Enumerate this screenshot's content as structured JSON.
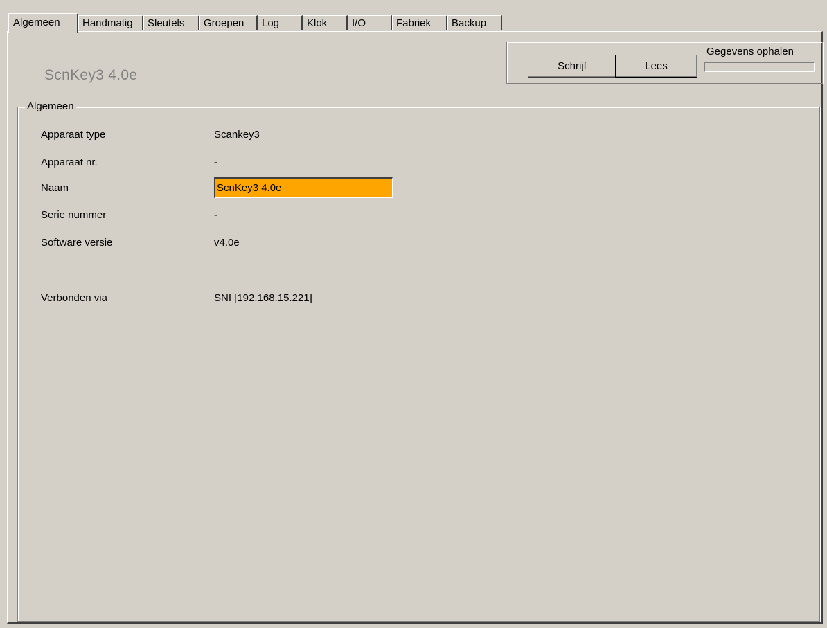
{
  "tabs": [
    {
      "label": "Algemeen",
      "active": true
    },
    {
      "label": "Handmatig",
      "active": false
    },
    {
      "label": "Sleutels",
      "active": false
    },
    {
      "label": "Groepen",
      "active": false
    },
    {
      "label": "Log",
      "active": false
    },
    {
      "label": "Klok",
      "active": false
    },
    {
      "label": "I/O",
      "active": false
    },
    {
      "label": "Fabriek",
      "active": false
    },
    {
      "label": "Backup",
      "active": false
    }
  ],
  "header": {
    "device_title": "ScnKey3 4.0e"
  },
  "actions": {
    "write_label": "Schrijf",
    "read_label": "Lees",
    "fetch_label": "Gegevens ophalen",
    "fetch_progress": 0
  },
  "general": {
    "group_title": "Algemeen",
    "rows": [
      {
        "label": "Apparaat type",
        "value": "Scankey3"
      },
      {
        "label": "Apparaat nr.",
        "value": "-"
      },
      {
        "label": "Naam",
        "value": "ScnKey3 4.0e"
      },
      {
        "label": "Serie nummer",
        "value": "-"
      },
      {
        "label": "Software versie",
        "value": "v4.0e"
      },
      {
        "label": "Verbonden via",
        "value": "SNI [192.168.15.221]"
      }
    ]
  },
  "colors": {
    "window_bg": "#d4d0c8",
    "name_field_bg": "#ffa500",
    "title_text": "#808080"
  }
}
